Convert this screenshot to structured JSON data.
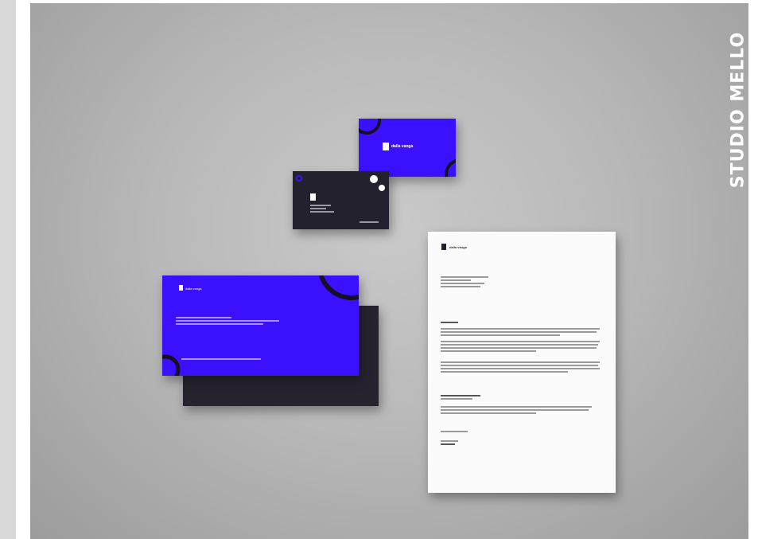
{
  "brand": {
    "vertical_title": "STUDIO MELLO"
  },
  "items": {
    "card_front": {
      "logo_text": "dalla vanga"
    },
    "envelope": {
      "logo_text": "dalla vanga"
    },
    "letter": {
      "logo_text": "dalla vanga"
    }
  },
  "colors": {
    "brand_blue": "#3a10ff",
    "brand_dark": "#24212e",
    "paper": "#fbfbfb"
  }
}
